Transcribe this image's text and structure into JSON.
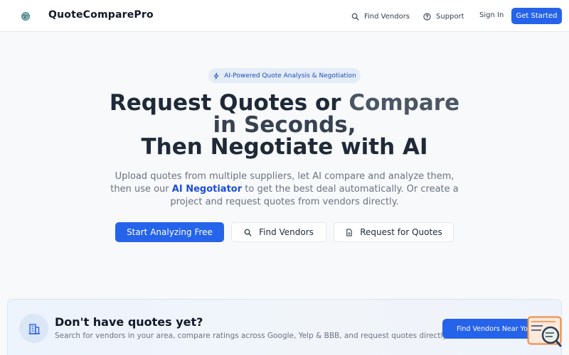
{
  "header": {
    "brand": "QuoteComparePro",
    "nav": {
      "find_vendors": "Find Vendors",
      "support": "Support",
      "sign_in": "Sign In",
      "get_started": "Get Started"
    }
  },
  "hero": {
    "badge": "AI-Powered Quote Analysis & Negotiation",
    "title_line1_a": "Request Quotes or ",
    "title_line1_b": "Compare",
    "title_line2": "in Seconds,",
    "title_line3": "Then Negotiate with AI",
    "subtitle_a": "Upload quotes from multiple suppliers, let AI compare and analyze them, then use our ",
    "subtitle_highlight": "AI Negotiator",
    "subtitle_b": " to get the best deal automatically. Or create a project and request quotes from vendors directly.",
    "buttons": {
      "start": "Start Analyzing Free",
      "find_vendors": "Find Vendors",
      "request": "Request for Quotes"
    }
  },
  "card": {
    "title": "Don't have quotes yet?",
    "description": "Search for vendors in your area, compare ratings across Google, Yelp & BBB, and request quotes directly.",
    "button": "Find Vendors Near You"
  },
  "colors": {
    "primary": "#2563eb",
    "badge_bg": "#e4ecf7",
    "card_bg": "#eef4fd",
    "widget_accent": "#f0883e"
  },
  "icons": {
    "logo": "globe-logo-icon",
    "find_vendors": "search-icon",
    "support": "help-circle-icon",
    "badge": "lightning-icon",
    "request": "document-icon",
    "card": "building-icon",
    "widget": "magnifier-widget-icon"
  }
}
